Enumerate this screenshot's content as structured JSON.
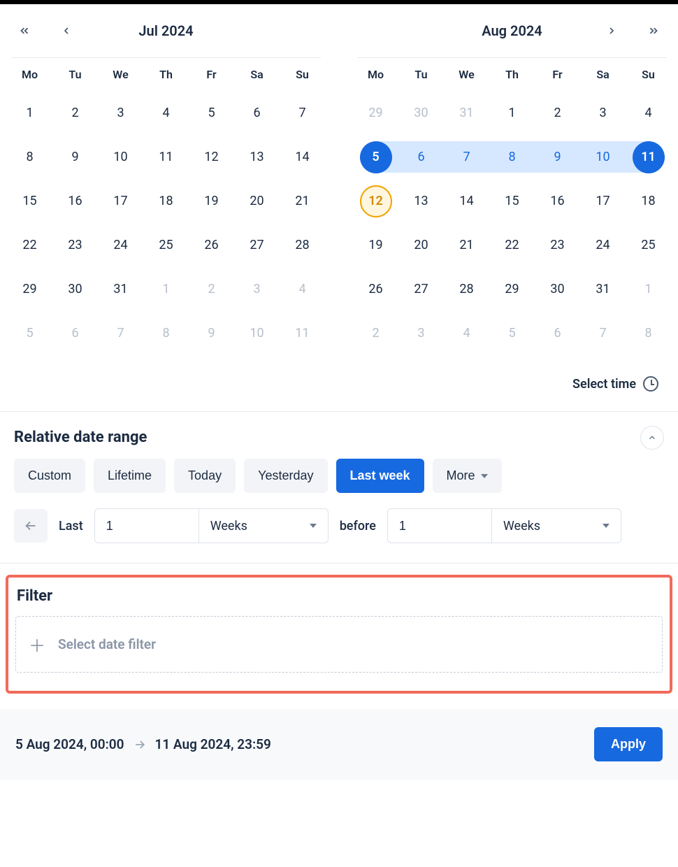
{
  "weekday_labels": [
    "Mo",
    "Tu",
    "We",
    "Th",
    "Fr",
    "Sa",
    "Su"
  ],
  "left_cal": {
    "title": "Jul 2024",
    "days": [
      {
        "n": 1
      },
      {
        "n": 2
      },
      {
        "n": 3
      },
      {
        "n": 4
      },
      {
        "n": 5
      },
      {
        "n": 6
      },
      {
        "n": 7
      },
      {
        "n": 8
      },
      {
        "n": 9
      },
      {
        "n": 10
      },
      {
        "n": 11
      },
      {
        "n": 12
      },
      {
        "n": 13
      },
      {
        "n": 14
      },
      {
        "n": 15
      },
      {
        "n": 16
      },
      {
        "n": 17
      },
      {
        "n": 18
      },
      {
        "n": 19
      },
      {
        "n": 20
      },
      {
        "n": 21
      },
      {
        "n": 22
      },
      {
        "n": 23
      },
      {
        "n": 24
      },
      {
        "n": 25
      },
      {
        "n": 26
      },
      {
        "n": 27
      },
      {
        "n": 28
      },
      {
        "n": 29
      },
      {
        "n": 30
      },
      {
        "n": 31
      },
      {
        "n": 1,
        "out": true
      },
      {
        "n": 2,
        "out": true
      },
      {
        "n": 3,
        "out": true
      },
      {
        "n": 4,
        "out": true
      },
      {
        "n": 5,
        "out": true
      },
      {
        "n": 6,
        "out": true
      },
      {
        "n": 7,
        "out": true
      },
      {
        "n": 8,
        "out": true
      },
      {
        "n": 9,
        "out": true
      },
      {
        "n": 10,
        "out": true
      },
      {
        "n": 11,
        "out": true
      }
    ]
  },
  "right_cal": {
    "title": "Aug 2024",
    "days": [
      {
        "n": 29,
        "out": true
      },
      {
        "n": 30,
        "out": true
      },
      {
        "n": 31,
        "out": true
      },
      {
        "n": 1
      },
      {
        "n": 2
      },
      {
        "n": 3
      },
      {
        "n": 4
      },
      {
        "n": 5,
        "sel": "start"
      },
      {
        "n": 6,
        "in": true
      },
      {
        "n": 7,
        "in": true
      },
      {
        "n": 8,
        "in": true
      },
      {
        "n": 9,
        "in": true
      },
      {
        "n": 10,
        "in": true
      },
      {
        "n": 11,
        "sel": "end"
      },
      {
        "n": 12,
        "today": true
      },
      {
        "n": 13
      },
      {
        "n": 14
      },
      {
        "n": 15
      },
      {
        "n": 16
      },
      {
        "n": 17
      },
      {
        "n": 18
      },
      {
        "n": 19
      },
      {
        "n": 20
      },
      {
        "n": 21
      },
      {
        "n": 22
      },
      {
        "n": 23
      },
      {
        "n": 24
      },
      {
        "n": 25
      },
      {
        "n": 26
      },
      {
        "n": 27
      },
      {
        "n": 28
      },
      {
        "n": 29
      },
      {
        "n": 30
      },
      {
        "n": 31
      },
      {
        "n": 1,
        "out": true
      },
      {
        "n": 2,
        "out": true
      },
      {
        "n": 3,
        "out": true
      },
      {
        "n": 4,
        "out": true
      },
      {
        "n": 5,
        "out": true
      },
      {
        "n": 6,
        "out": true
      },
      {
        "n": 7,
        "out": true
      },
      {
        "n": 8,
        "out": true
      }
    ]
  },
  "select_time_label": "Select time",
  "relative": {
    "title": "Relative date range",
    "presets": [
      "Custom",
      "Lifetime",
      "Today",
      "Yesterday",
      "Last week",
      "More"
    ],
    "active_preset": "Last week",
    "last_label": "Last",
    "last_value": "1",
    "last_unit": "Weeks",
    "before_label": "before",
    "before_value": "1",
    "before_unit": "Weeks"
  },
  "filter": {
    "title": "Filter",
    "add_label": "Select date filter"
  },
  "footer": {
    "from": "5 Aug 2024, 00:00",
    "to": "11 Aug 2024, 23:59",
    "apply": "Apply"
  }
}
